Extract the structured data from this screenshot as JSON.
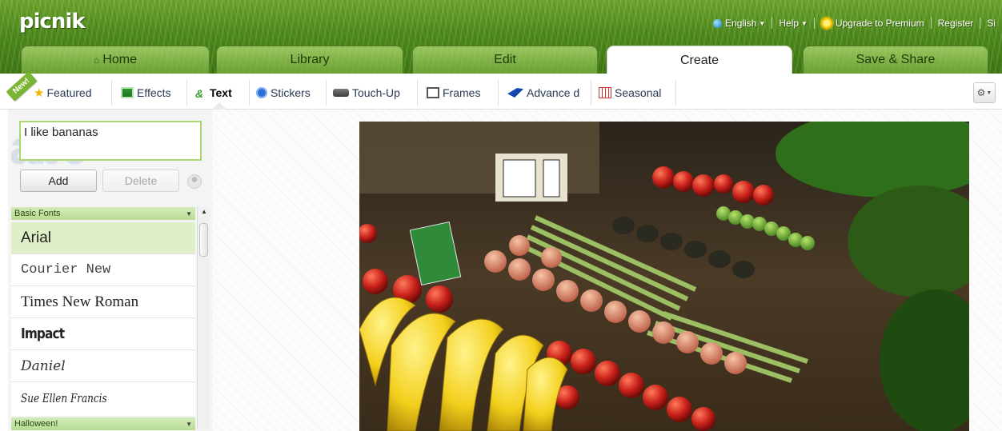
{
  "app": {
    "logo": "picnik"
  },
  "top_nav": {
    "language": "English",
    "help": "Help",
    "upgrade": "Upgrade to Premium",
    "register": "Register",
    "sign_in_partial": "Si"
  },
  "main_tabs": [
    {
      "label": "Home",
      "icon": "home-icon"
    },
    {
      "label": "Library"
    },
    {
      "label": "Edit"
    },
    {
      "label": "Create",
      "active": true
    },
    {
      "label": "Save & Share"
    }
  ],
  "toolbar": {
    "new_badge": "New!",
    "items": [
      {
        "label": "Featured",
        "icon": "star-icon"
      },
      {
        "label": "Effects",
        "icon": "effects-icon"
      },
      {
        "label": "Text",
        "icon": "text-icon",
        "active": true
      },
      {
        "label": "Stickers",
        "icon": "sticker-icon"
      },
      {
        "label": "Touch-Up",
        "icon": "touchup-icon"
      },
      {
        "label": "Frames",
        "icon": "frames-icon"
      },
      {
        "label": "Advance d",
        "icon": "advanced-icon"
      },
      {
        "label": "Seasonal",
        "icon": "calendar-icon"
      }
    ],
    "settings_icon": "gear-icon"
  },
  "text_panel": {
    "watermark": "abc",
    "input_value": "I like bananas",
    "add_label": "Add",
    "delete_label": "Delete",
    "sections": [
      {
        "label": "Basic Fonts"
      },
      {
        "label": "Halloween!"
      }
    ],
    "fonts": [
      {
        "name": "Arial",
        "selected": true
      },
      {
        "name": "Courier New"
      },
      {
        "name": "Times New Roman"
      },
      {
        "name": "Impact"
      },
      {
        "name": "Daniel"
      },
      {
        "name": "Sue Ellen Francis"
      }
    ]
  },
  "photo": {
    "subject": "market stall with bananas, tomatoes, asparagus and produce"
  },
  "colors": {
    "header_green": "#4e8a1c",
    "section_green": "#c6e4a6",
    "input_border": "#a9d86e"
  }
}
